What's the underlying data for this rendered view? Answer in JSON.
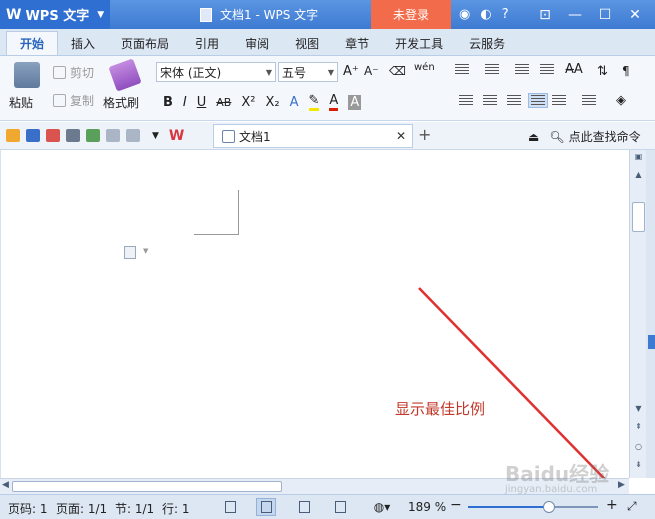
{
  "titlebar": {
    "app_label": "WPS 文字",
    "document_title": "文档1 - WPS 文字",
    "login_label": "未登录",
    "icons": [
      "skin-icon",
      "feedback-icon",
      "help-icon",
      "ribbon-toggle-icon",
      "minimize-icon",
      "maximize-icon",
      "close-icon"
    ]
  },
  "menu": {
    "tabs": [
      "开始",
      "插入",
      "页面布局",
      "引用",
      "审阅",
      "视图",
      "章节",
      "开发工具",
      "云服务"
    ],
    "active_tab": "开始"
  },
  "ribbon": {
    "paste_label": "粘贴",
    "cut_label": "剪切",
    "copy_label": "复制",
    "format_painter_label": "格式刷",
    "font_name": "宋体 (正文)",
    "font_size": "五号",
    "format_buttons": [
      "B",
      "I",
      "U",
      "AB",
      "X²",
      "X₂"
    ]
  },
  "quickbar": {
    "doc_tab_label": "文档1",
    "search_label": "点此查找命令"
  },
  "document": {
    "annotation_text": "显示最佳比例",
    "annotation_color": "#c0392b"
  },
  "statusbar": {
    "page_label": "页码: 1",
    "pages_label": "页面: 1/1",
    "section_label": "节: 1/1",
    "line_label": "行: 1",
    "zoom_label": "189 %",
    "zoom_fraction": 0.62
  },
  "watermark": {
    "text": "Baidu经验",
    "subtext": "jingyan.baidu.com"
  },
  "colors": {
    "titlebar": "#3d7ad2",
    "login_button": "#f26b4a",
    "accent": "#2f6fd1"
  }
}
